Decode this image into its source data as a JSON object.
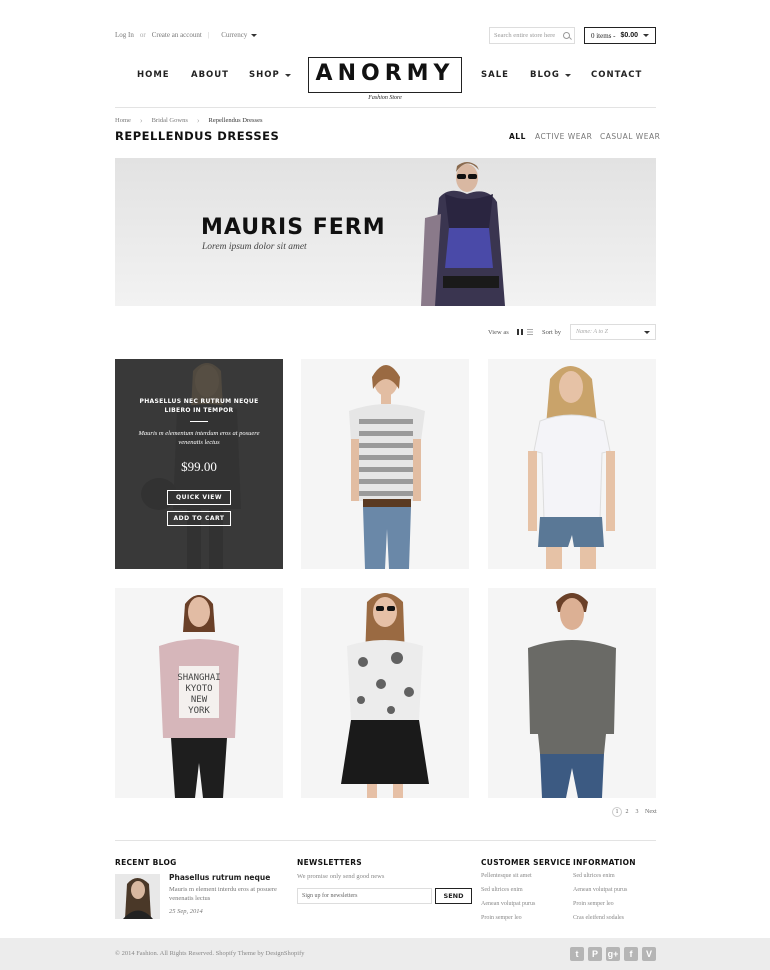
{
  "header": {
    "login": "Log In",
    "or": "or",
    "create_account": "Create an account",
    "currency": "Currency",
    "search_placeholder": "Search entire store here",
    "cart_items": "0 items -",
    "cart_total": "$0.00"
  },
  "nav": {
    "home": "HOME",
    "about": "ABOUT",
    "shop": "SHOP",
    "sale": "SALE",
    "blog": "BLOG",
    "contact": "CONTACT"
  },
  "logo": {
    "name": "ANORMY",
    "tagline": "Fashion Store"
  },
  "breadcrumb": {
    "home": "Home",
    "bridal": "Bridal Gowns",
    "current": "Repellendus Dresses"
  },
  "page": {
    "title": "REPELLENDUS DRESSES"
  },
  "filters": {
    "all": "ALL",
    "active": "ACTIVE WEAR",
    "casual": "CASUAL WEAR"
  },
  "banner": {
    "title": "MAURIS FERM",
    "subtitle": "Lorem ipsum dolor sit amet"
  },
  "toolbar": {
    "view_as": "View as",
    "sort_by": "Sort by",
    "sort_value": "Name: A to Z"
  },
  "hover_product": {
    "title": "PHASELLUS NEC RUTRUM NEQUE LIBERO IN TEMPOR",
    "desc": "Mauris m elementum interdum eros at posuere venenatis lectus",
    "price": "$99.00",
    "quick_view": "QUICK VIEW",
    "add_to_cart": "ADD TO CART"
  },
  "pagination": {
    "p1": "1",
    "p2": "2",
    "p3": "3",
    "next": "Next"
  },
  "footer": {
    "recent_blog": "RECENT BLOG",
    "blog_title": "Phasellus rutrum neque",
    "blog_text": "Mauris m element interdu eros at posuere venenatis lectus",
    "blog_date": "25 Sep, 2014",
    "newsletters": "NEWSLETTERS",
    "nl_text": "We promise only send good news",
    "nl_placeholder": "Sign up for newsletters",
    "send": "SEND",
    "customer_service": "CUSTOMER SERVICE",
    "cs_links": [
      "Pellentesque sit amet",
      "Sed ultrices enim",
      "Aenean volutpat purus",
      "Proin semper leo"
    ],
    "information": "INFORMATION",
    "info_links": [
      "Sed ultrices enim",
      "Aenean volutpat purus",
      "Proin semper leo",
      "Cras eleifend sodales"
    ],
    "copyright": "© 2014 Fashion. All Rights Reserved. Shopify Theme by DesignShopify"
  },
  "social": [
    "tumblr-icon",
    "pinterest-icon",
    "google-plus-icon",
    "facebook-icon",
    "vimeo-icon"
  ]
}
